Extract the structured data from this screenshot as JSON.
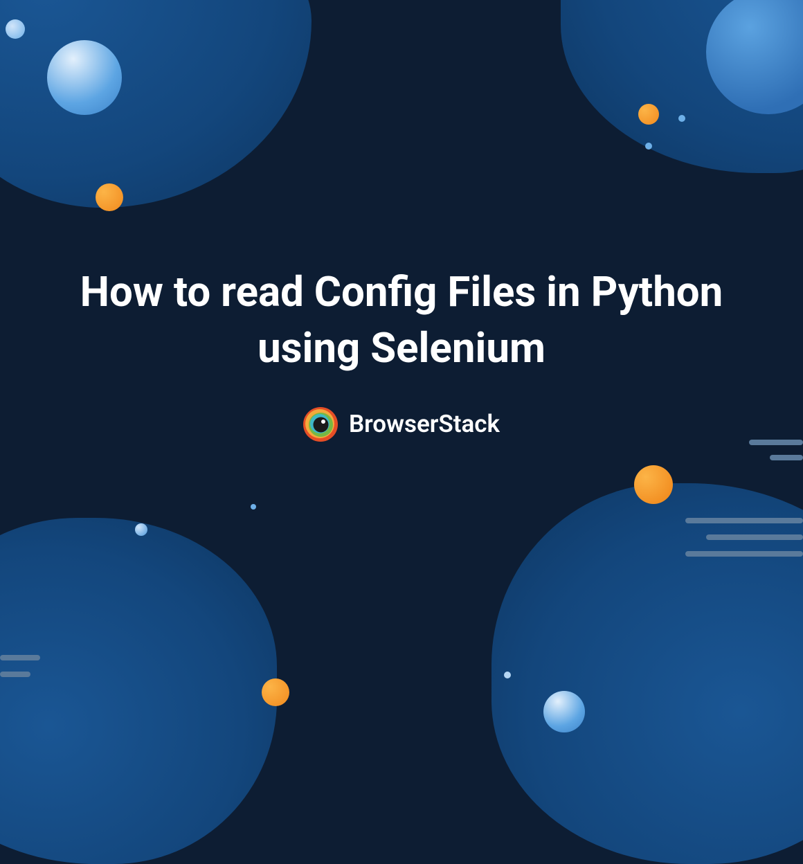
{
  "title": "How to read Config Files in Python using Selenium",
  "brand": "BrowserStack",
  "colors": {
    "background": "#0d1d33",
    "blob": "#13467c",
    "orange": "#f18a1e",
    "blue_light": "#6eb0e8",
    "text": "#ffffff"
  }
}
